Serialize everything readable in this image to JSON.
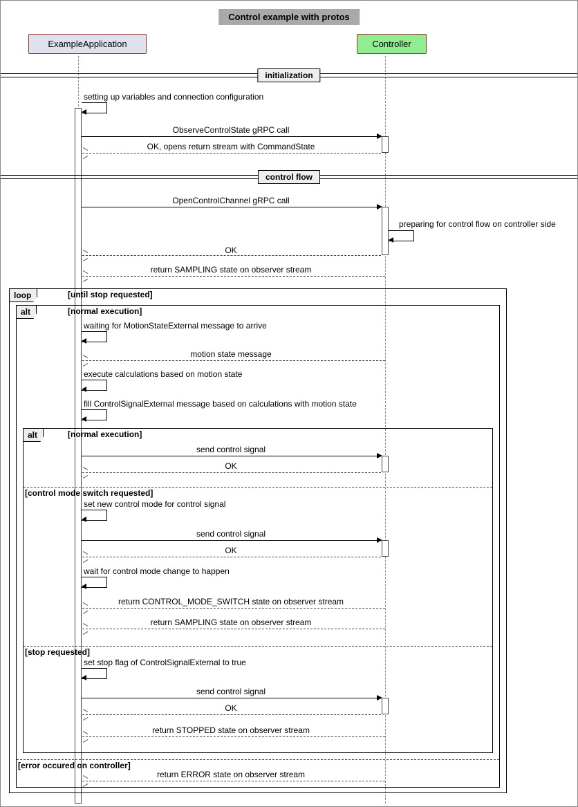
{
  "title": "Control example with protos",
  "participants": {
    "app": "ExampleApplication",
    "ctrl": "Controller"
  },
  "dividers": {
    "init": "initialization",
    "flow": "control flow"
  },
  "messages": {
    "m1": "setting up variables and connection configuration",
    "m2": "ObserveControlState gRPC call",
    "m3": "OK, opens return stream with CommandState",
    "m4": "OpenControlChannel gRPC call",
    "m5": "preparing for control flow on controller side",
    "m6": "OK",
    "m7": "return SAMPLING state on observer stream",
    "m8": "waiting for MotionStateExternal message to arrive",
    "m9": "motion state message",
    "m10": "execute calculations based on motion state",
    "m11": "fill ControlSignalExternal message based on calculations with motion state",
    "m12": "send control signal",
    "m13": "OK",
    "m14": "set new control mode for control signal",
    "m15": "send control signal",
    "m16": "OK",
    "m17": "wait for control mode change to happen",
    "m18": "return CONTROL_MODE_SWITCH state on observer stream",
    "m19": "return SAMPLING state on observer stream",
    "m20": "set stop flag of ControlSignalExternal to true",
    "m21": "send control signal",
    "m22": "OK",
    "m23": "return STOPPED state on observer stream",
    "m24": "return ERROR state on observer stream"
  },
  "fragments": {
    "loop": "loop",
    "loopCond": "[until stop requested]",
    "alt": "alt",
    "alt1Cond": "[normal execution]",
    "alt2Cond": "[normal execution]",
    "alt2b": "[control mode switch requested]",
    "alt2c": "[stop requested]",
    "alt1b": "[error occured on controller]"
  }
}
